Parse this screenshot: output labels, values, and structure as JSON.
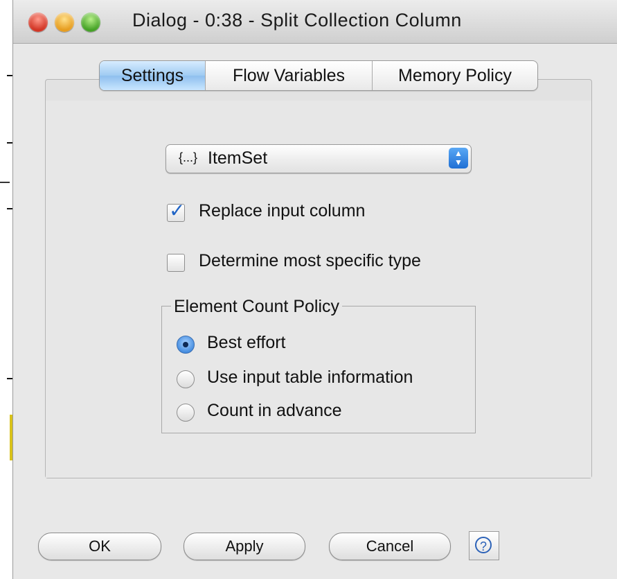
{
  "window": {
    "title": "Dialog - 0:38 - Split Collection Column"
  },
  "tabs": [
    {
      "label": "Settings",
      "active": true
    },
    {
      "label": "Flow Variables",
      "active": false
    },
    {
      "label": "Memory Policy",
      "active": false
    }
  ],
  "settings": {
    "column_select": {
      "icon_text": "{...}",
      "value": "ItemSet"
    },
    "replace_input_column": {
      "label": "Replace input column",
      "checked": true
    },
    "determine_specific_type": {
      "label": "Determine most specific type",
      "checked": false
    },
    "element_count_policy": {
      "legend": "Element Count Policy",
      "options": [
        {
          "label": "Best effort",
          "selected": true
        },
        {
          "label": "Use input table information",
          "selected": false
        },
        {
          "label": "Count in advance",
          "selected": false
        }
      ]
    }
  },
  "buttons": {
    "ok": "OK",
    "apply": "Apply",
    "cancel": "Cancel",
    "help": "?"
  },
  "colors": {
    "accent": "#3a85dc",
    "window_bg": "#e8e8e8"
  }
}
